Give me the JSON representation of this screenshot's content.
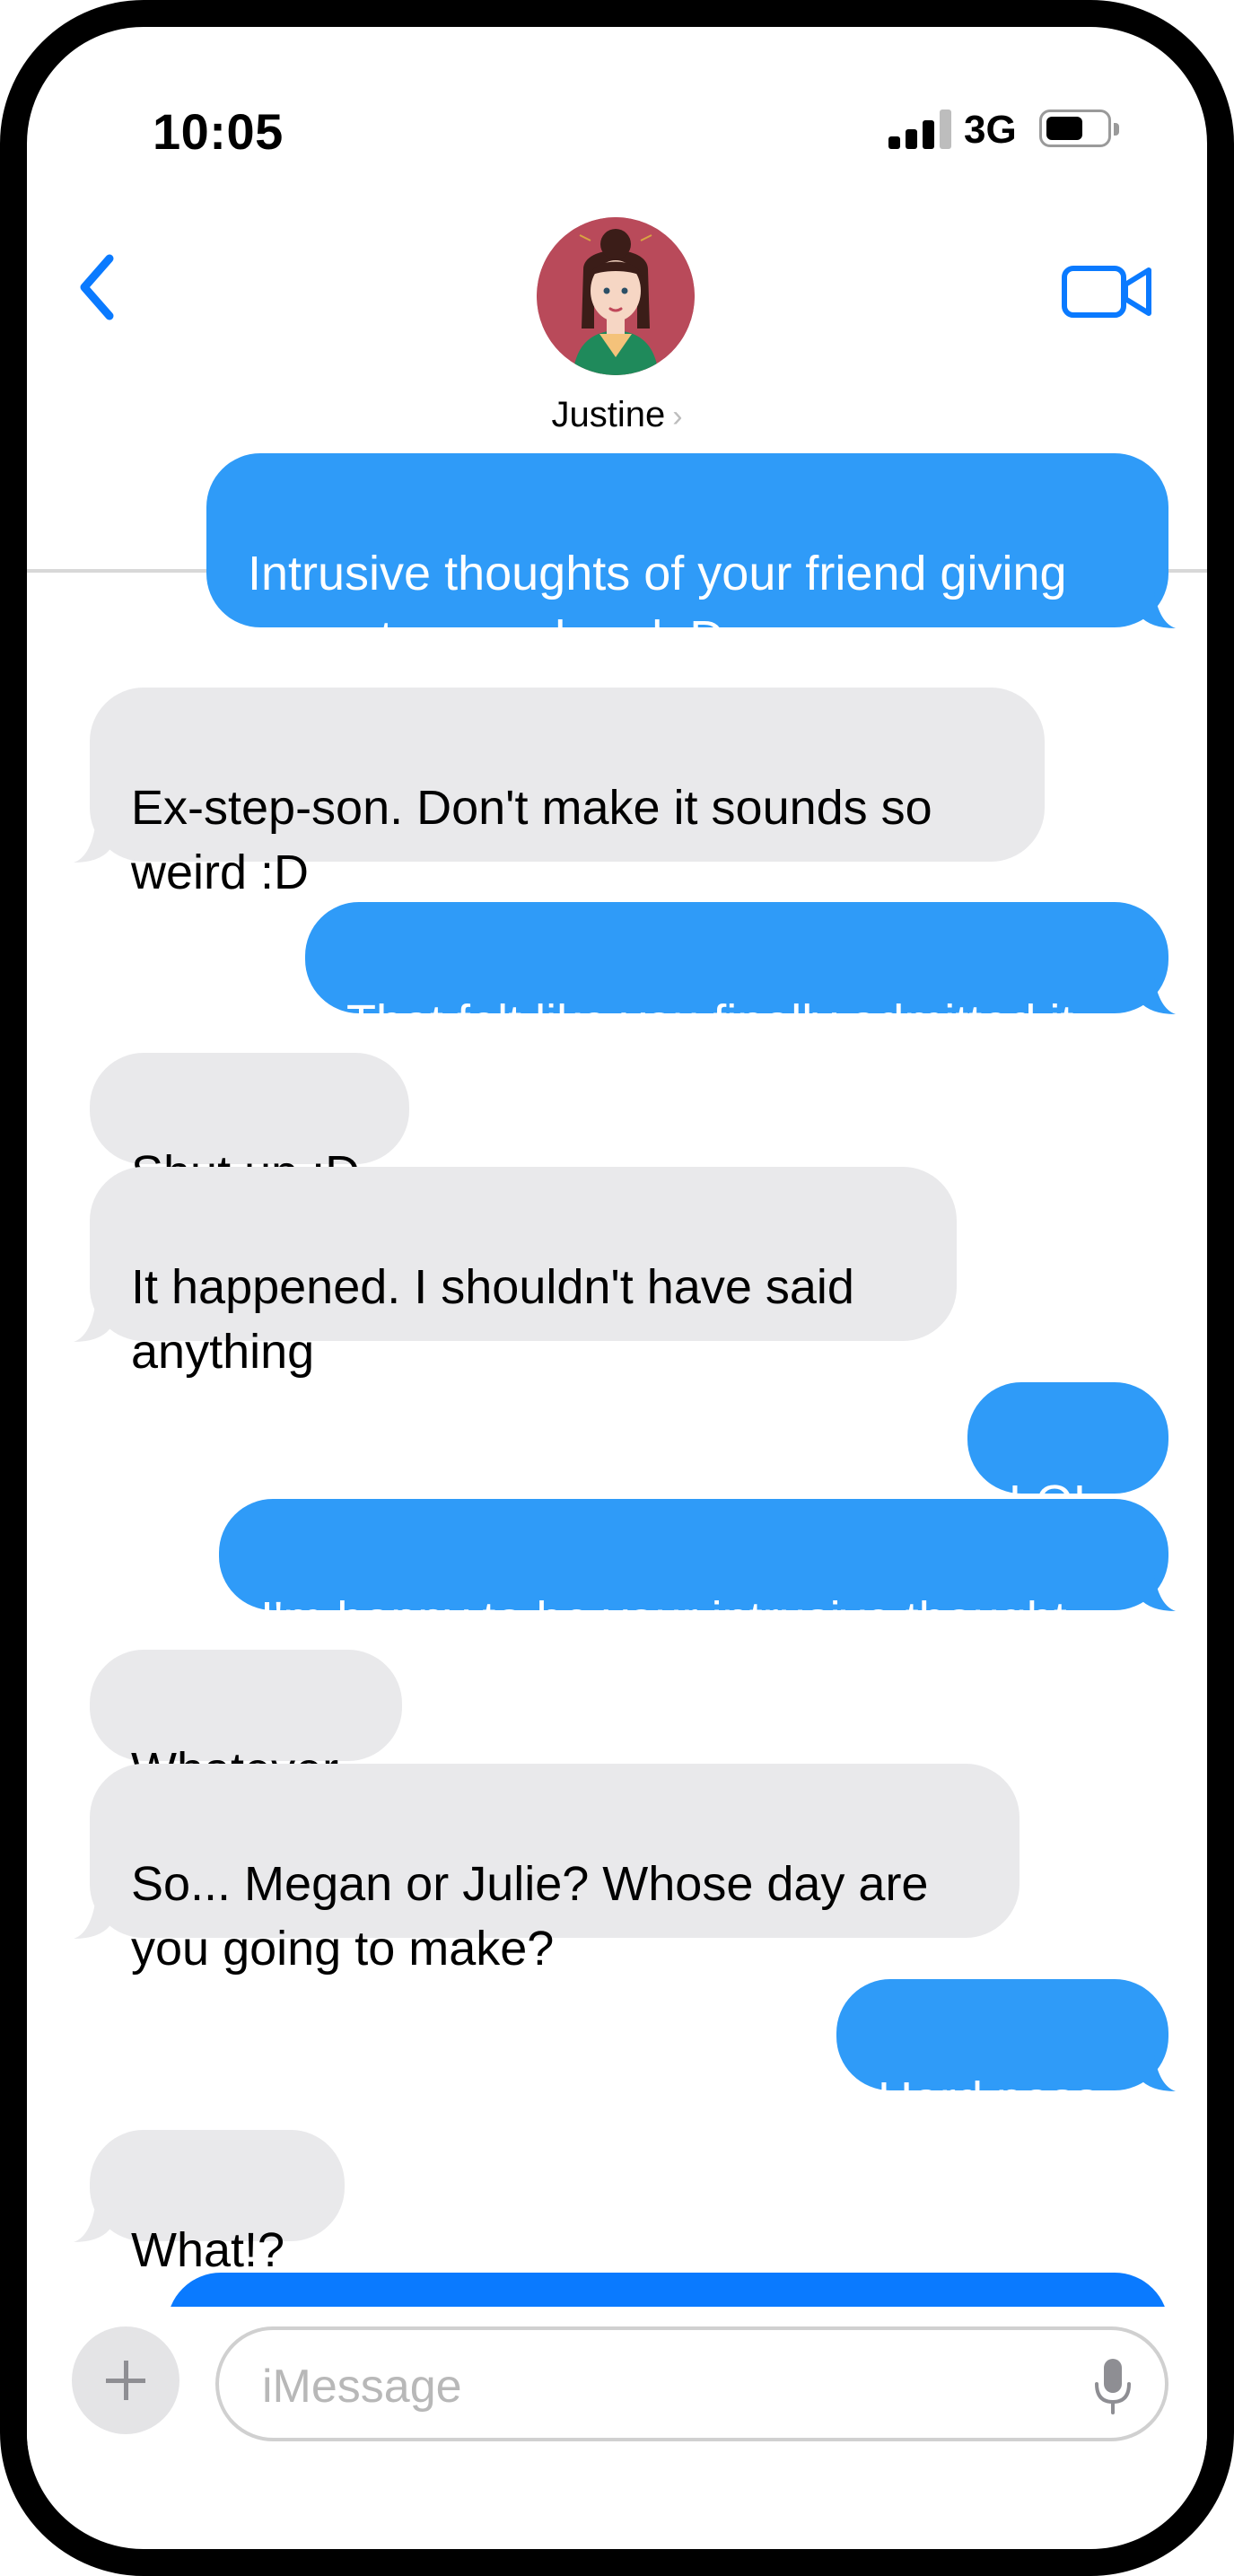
{
  "status_bar": {
    "time": "10:05",
    "network": "3G",
    "signal_bars": 3,
    "signal_bars_total": 4,
    "battery_icon": "battery-icon"
  },
  "header": {
    "contact_name": "Justine",
    "back_icon": "chevron-left-icon",
    "video_icon": "video-camera-icon"
  },
  "messages": [
    {
      "direction": "sent",
      "text": "Intrusive thoughts of your friend giving\nyour step-son head :D"
    },
    {
      "direction": "received",
      "text": "Ex-step-son.  Don't make it sounds so\nweird :D"
    },
    {
      "direction": "sent",
      "text": "That felt like you finally admitted it"
    },
    {
      "direction": "received",
      "text": "Shut up :D"
    },
    {
      "direction": "received",
      "text": "It happened.  I shouldn't have said\nanything"
    },
    {
      "direction": "sent",
      "text": "LOL"
    },
    {
      "direction": "sent",
      "text": "I'm happy to be your intrusive thought"
    },
    {
      "direction": "received",
      "text": "Whatever"
    },
    {
      "direction": "received",
      "text": "So... Megan or Julie?  Whose day are\nyou going to make?"
    },
    {
      "direction": "sent",
      "text": "Hard pass"
    },
    {
      "direction": "received",
      "text": "What!?"
    },
    {
      "direction": "sent",
      "text": ""
    }
  ],
  "input_bar": {
    "placeholder": "iMessage",
    "value": "",
    "plus_icon": "plus-icon",
    "mic_icon": "microphone-icon"
  },
  "colors": {
    "sent_bubble": "#2f9bf8",
    "received_bubble": "#e9e9eb",
    "accent": "#0a7aff"
  }
}
